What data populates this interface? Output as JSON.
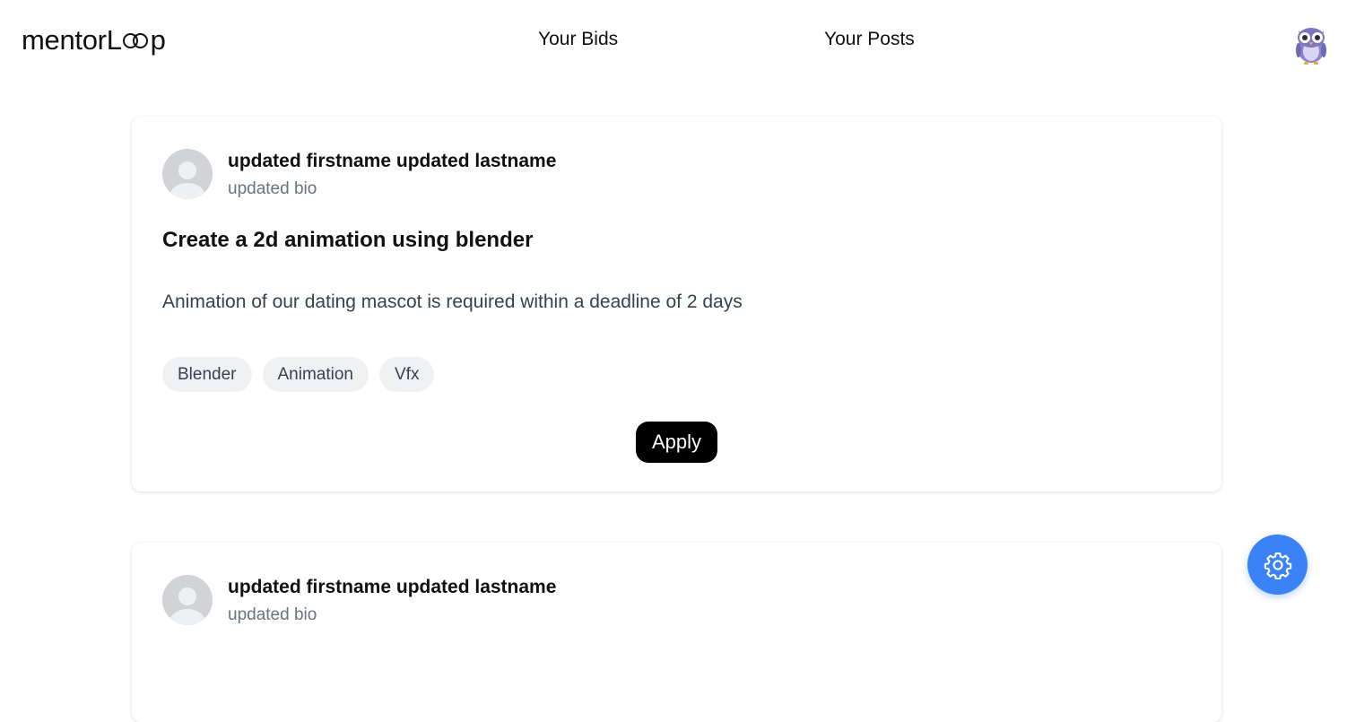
{
  "header": {
    "logo_prefix": "mentor",
    "logo_L": "L",
    "logo_p": "p",
    "nav": [
      {
        "label": "Your Bids"
      },
      {
        "label": "Your Posts"
      }
    ],
    "profile_icon": "owl-avatar-icon"
  },
  "posts": [
    {
      "author_name": "updated firstname updated lastname",
      "author_bio": "updated bio",
      "title": "Create a 2d animation using blender",
      "description": "Animation of our dating mascot is required within a deadline of 2 days",
      "tags": [
        "Blender",
        "Animation",
        "Vfx"
      ],
      "apply_label": "Apply"
    },
    {
      "author_name": "updated firstname updated lastname",
      "author_bio": "updated bio"
    }
  ],
  "fab": {
    "icon": "gear-icon",
    "color": "#3b82f6"
  },
  "colors": {
    "button_bg": "#000000",
    "tag_bg": "#f0f1f3",
    "muted_text": "#6b7280"
  }
}
